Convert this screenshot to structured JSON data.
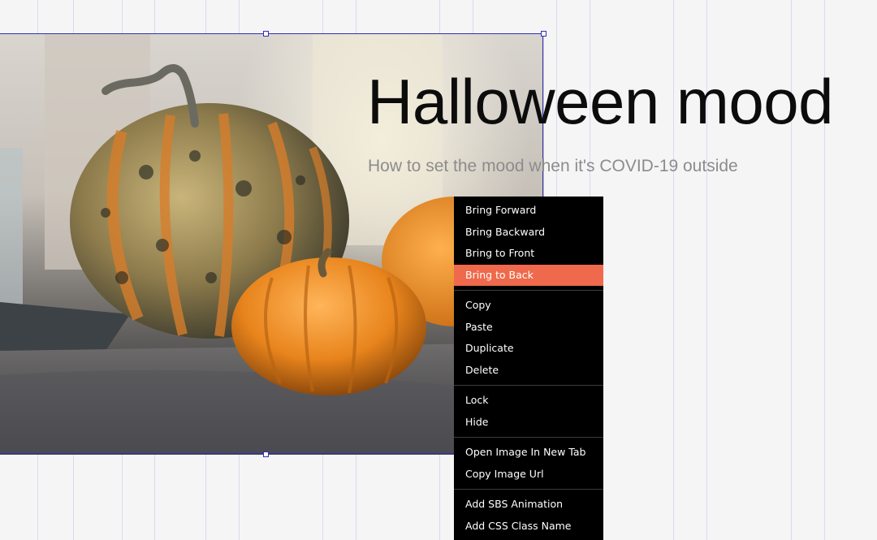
{
  "heading": {
    "title": "Halloween mood",
    "subtitle": "How to set the mood when it's COVID-19 outside"
  },
  "image": {
    "subject": "pumpkins on a windowsill",
    "selected": true
  },
  "context_menu": {
    "highlight_color": "#ef6a4c",
    "groups": [
      [
        {
          "label": "Bring Forward"
        },
        {
          "label": "Bring Backward"
        },
        {
          "label": "Bring to Front"
        },
        {
          "label": "Bring to Back",
          "highlighted": true
        }
      ],
      [
        {
          "label": "Copy"
        },
        {
          "label": "Paste"
        },
        {
          "label": "Duplicate"
        },
        {
          "label": "Delete"
        }
      ],
      [
        {
          "label": "Lock"
        },
        {
          "label": "Hide"
        }
      ],
      [
        {
          "label": "Open Image In New Tab"
        },
        {
          "label": "Copy Image Url"
        }
      ],
      [
        {
          "label": "Add SBS Animation"
        },
        {
          "label": "Add CSS Class Name"
        }
      ]
    ]
  }
}
